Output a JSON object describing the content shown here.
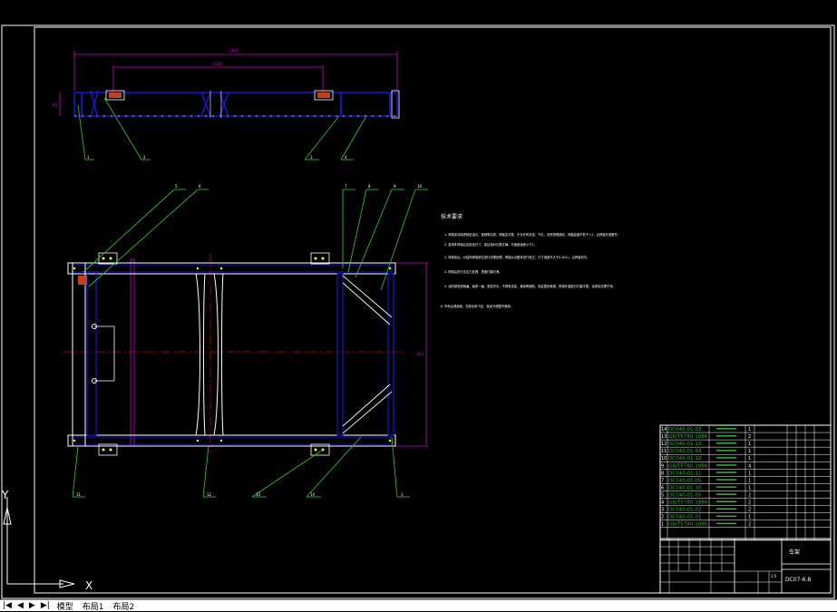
{
  "ucs": {
    "y_label": "Y",
    "x_label": "X"
  },
  "tabs": [
    {
      "label": "模型"
    },
    {
      "label": "布局1"
    },
    {
      "label": "布局2"
    }
  ],
  "nav": {
    "first": "|◀",
    "prev": "◀",
    "next": "▶",
    "last": "▶|"
  },
  "tech_title": "技术要求",
  "tech_items": [
    "1. 焊接前清除焊接处油污、铁锈等杂质，焊缝应平整，不允许有夹渣、气孔、未焊透等缺陷，焊缝高度不低于1.0，且焊缝外观整齐。",
    "2. 各零件焊接后应检查尺寸，保证相对位置正确，平面度误差小于2。",
    "3. 焊接前后，对结构焊接部位进行清理处理，焊接后对整体进行校正，尺寸误差不大于0.001L，且焊缝均匀。",
    "4. 焊接后进行去应力处理，表面打磨光滑。",
    "5. 涂防锈底漆两遍，面漆一遍，漆层均匀，不得有流挂、漏涂等缺陷，保证整体美观，焊接外露部分打磨平整，涂漆前清理干净。",
    "6. 所有尖角倒钝，去除毛刺飞边，保证外观整齐美观。"
  ],
  "bom_rows": [
    {
      "no": "14",
      "code": "DC040-01-03",
      "qty": "1"
    },
    {
      "no": "13",
      "code": "GB/T5780-1986",
      "qty": "2"
    },
    {
      "no": "12",
      "code": "DC040-01-13",
      "qty": "1"
    },
    {
      "no": "11",
      "code": "DC040-01-04",
      "qty": "1"
    },
    {
      "no": "10",
      "code": "DC040-01-12",
      "qty": "1"
    },
    {
      "no": "9",
      "code": "GB/T5780-1986",
      "qty": "4"
    },
    {
      "no": "8",
      "code": "DC040-01-11",
      "qty": "1"
    },
    {
      "no": "7",
      "code": "DC040-01-05",
      "qty": "1"
    },
    {
      "no": "6",
      "code": "DC040-01-10",
      "qty": "1"
    },
    {
      "no": "5",
      "code": "DC040-01-05",
      "qty": "2"
    },
    {
      "no": "4",
      "code": "GB/T5780-1986",
      "qty": "2"
    },
    {
      "no": "3",
      "code": "DC040-01-02",
      "qty": "2"
    },
    {
      "no": "2",
      "code": "DC040-01-01",
      "qty": "1"
    },
    {
      "no": "1",
      "code": "GB/T5780-1986",
      "qty": "2"
    }
  ],
  "title_block": {
    "drawing_name": "车架",
    "drawing_no": "DC07-6.8",
    "scale": "1:5"
  },
  "balloons_top": [
    "1",
    "2",
    "3",
    "4"
  ],
  "balloons_mid": [
    "5",
    "6",
    "7",
    "8",
    "9",
    "10"
  ],
  "balloons_bottom": [
    "11",
    "12",
    "13",
    "14",
    "1"
  ],
  "dims": {
    "overall": "1800",
    "inner": "1200",
    "height": "80",
    "width": "800"
  },
  "colors": {
    "background": "#000000",
    "frame": "#ffffff",
    "part": "#1a1aff",
    "leader": "#2eb82e",
    "dimension": "#cc00cc",
    "center": "#cc0000",
    "bolt": "#ffff00"
  }
}
